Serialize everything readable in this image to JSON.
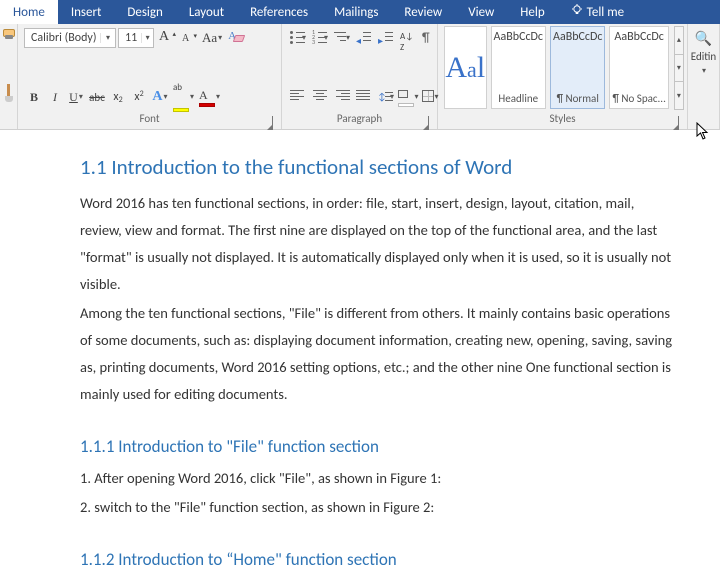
{
  "tabs": {
    "home": "Home",
    "insert": "Insert",
    "design": "Design",
    "layout": "Layout",
    "references": "References",
    "mailings": "Mailings",
    "review": "Review",
    "view": "View",
    "help": "Help",
    "tellme": "Tell me"
  },
  "font": {
    "name": "Calibri (Body)",
    "size": "11",
    "group_label": "Font"
  },
  "paragraph": {
    "group_label": "Paragraph"
  },
  "styles": {
    "group_label": "Styles",
    "items": [
      {
        "name": "Headline",
        "sample": "AaBbCcDc"
      },
      {
        "name": "¶ Normal",
        "sample": "AaBbCcDc"
      },
      {
        "name": "¶ No Spac...",
        "sample": "AaBbCcDc"
      }
    ]
  },
  "editing": {
    "label": "Editin"
  },
  "doc": {
    "h1": "1.1 Introduction to the functional sections of Word",
    "p1": "Word 2016 has ten functional sections, in order: file, start, insert, design, layout, citation, mail, review, view and format. The first nine are displayed on the top of the functional area, and the last \"format\" is usually not displayed. It is automatically displayed only when it is used, so it is usually not visible.",
    "p2": "Among the ten functional sections, \"File\" is different from others. It mainly contains basic operations of some documents, such as: displaying document information, creating new, opening, saving, saving as, printing documents, Word 2016 setting options, etc.; and the other nine One functional section is mainly used for editing documents.",
    "h2a": "1.1.1 Introduction to \"File\" function section",
    "p3": "1. After opening Word 2016, click \"File\", as shown in Figure 1:",
    "p4": "2. switch to the \"File\" function section, as shown in Figure 2:",
    "h2b": "1.1.2 Introduction to “Home\" function section"
  }
}
